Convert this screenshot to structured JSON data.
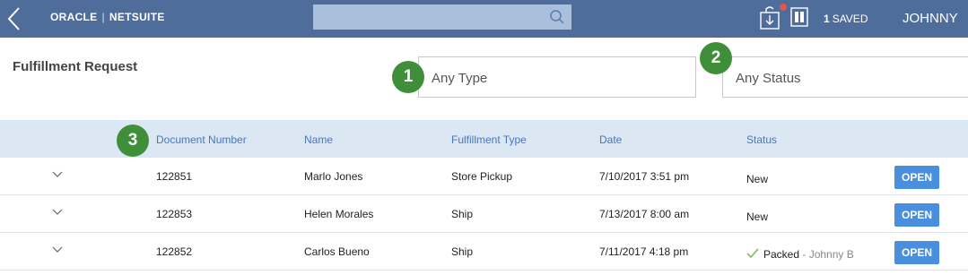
{
  "header": {
    "brand": "ORACLE",
    "brand_sep": "|",
    "brand_product": "NETSUITE",
    "search_placeholder": "",
    "saved_count": "1",
    "saved_label": "SAVED",
    "user_name": "JOHNNY"
  },
  "page": {
    "title": "Fulfillment Request"
  },
  "filters": {
    "type_value": "Any Type",
    "status_value": "Any Status"
  },
  "callouts": [
    "1",
    "2",
    "3"
  ],
  "table": {
    "columns": [
      "Document Number",
      "Name",
      "Fulfillment Type",
      "Date",
      "Status"
    ],
    "rows": [
      {
        "doc": "122851",
        "name": "Marlo Jones",
        "type": "Store Pickup",
        "date": "7/10/2017 3:51 pm",
        "status": "New",
        "by": "",
        "action": "OPEN"
      },
      {
        "doc": "122853",
        "name": "Helen Morales",
        "type": "Ship",
        "date": "7/13/2017 8:00 am",
        "status": "New",
        "by": "",
        "action": "OPEN"
      },
      {
        "doc": "122852",
        "name": "Carlos Bueno",
        "type": "Ship",
        "date": "7/11/2017 4:18 pm",
        "status": "Packed",
        "by": " - Johnny B",
        "action": "OPEN"
      }
    ]
  },
  "colors": {
    "topbar": "#4f6d9a",
    "header_row": "#dbe7f3",
    "callout": "#3f8f3a",
    "open_button": "#4a8fdd",
    "link": "#4a77b5"
  },
  "icons": [
    "back-arrow-icon",
    "search-icon",
    "download-icon",
    "saved-searches-icon",
    "chevron-down-icon",
    "checkmark-icon"
  ]
}
